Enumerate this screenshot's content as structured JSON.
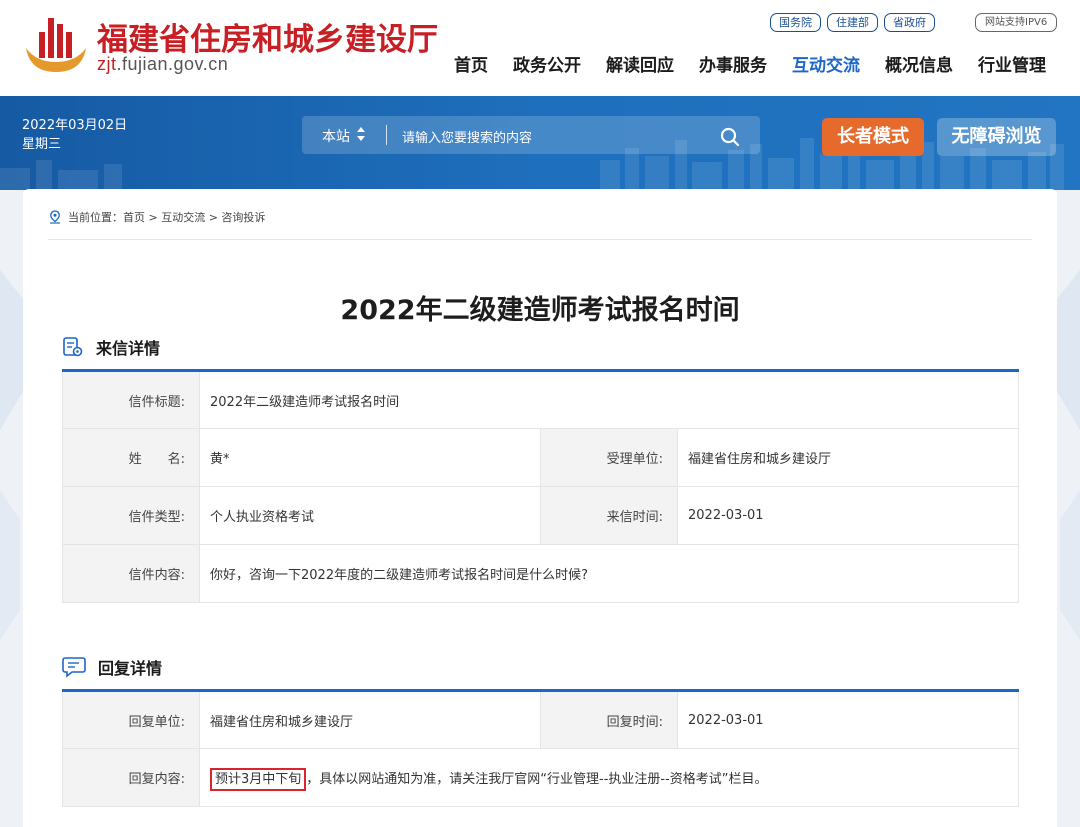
{
  "header": {
    "site_title": "福建省住房和城乡建设厅",
    "site_url_prefix": "zjt",
    "site_url_rest": ".fujian.gov.cn",
    "top_links": [
      "国务院",
      "住建部",
      "省政府"
    ],
    "ipv6_label": "网站支持IPV6",
    "nav": [
      {
        "label": "首页"
      },
      {
        "label": "政务公开"
      },
      {
        "label": "解读回应"
      },
      {
        "label": "办事服务"
      },
      {
        "label": "互动交流"
      },
      {
        "label": "概况信息"
      },
      {
        "label": "行业管理"
      }
    ],
    "active_nav": "互动交流"
  },
  "banner": {
    "date": "2022年03月02日",
    "weekday": "星期三",
    "search_scope": "本站",
    "search_placeholder": "请输入您要搜索的内容",
    "elder_mode": "长者模式",
    "accessible_mode": "无障碍浏览"
  },
  "breadcrumb": "当前位置：首页 > 互动交流 > 咨询投诉",
  "title": "2022年二级建造师考试报名时间",
  "letter": {
    "heading": "来信详情",
    "rows": {
      "subject_label": "信件标题:",
      "subject": "2022年二级建造师考试报名时间",
      "name_label": "姓　　名:",
      "name": "黄*",
      "unit_label": "受理单位:",
      "unit": "福建省住房和城乡建设厅",
      "type_label": "信件类型:",
      "type": "个人执业资格考试",
      "time_label": "来信时间:",
      "time": "2022-03-01",
      "content_label": "信件内容:",
      "content": "你好，咨询一下2022年度的二级建造师考试报名时间是什么时候?"
    }
  },
  "reply": {
    "heading": "回复详情",
    "rows": {
      "unit_label": "回复单位:",
      "unit": "福建省住房和城乡建设厅",
      "time_label": "回复时间:",
      "time": "2022-03-01",
      "content_label": "回复内容:",
      "content_highlight": "预计3月中下旬",
      "content_rest": "，具体以网站通知为准，请关注我厅官网“行业管理--执业注册--资格考试”栏目。"
    }
  },
  "colors": {
    "brand_red": "#c81f25",
    "accent_blue": "#1b66c9",
    "banner_blue": "#1e6fbd",
    "elder_orange": "#e56a2c",
    "highlight_red": "#d9242b"
  }
}
